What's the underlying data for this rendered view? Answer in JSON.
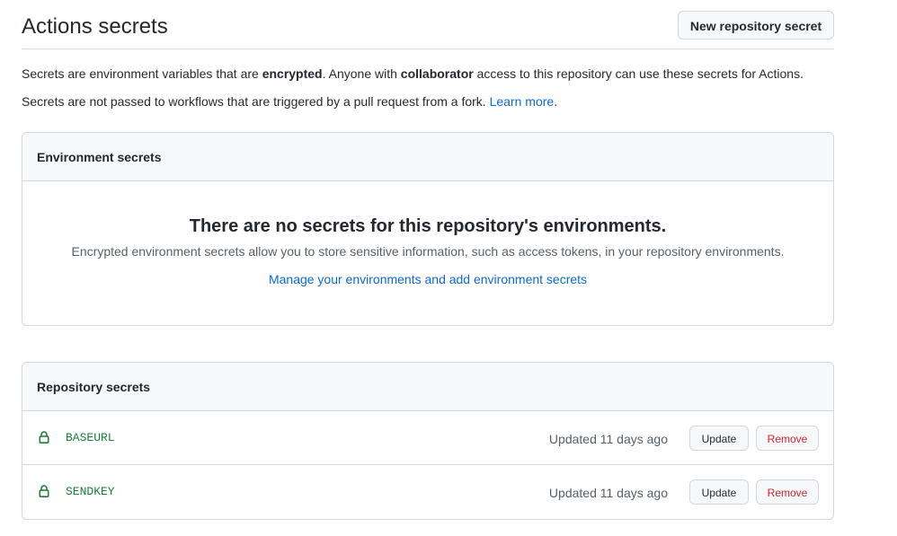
{
  "header": {
    "title": "Actions secrets",
    "new_secret_label": "New repository secret"
  },
  "description": {
    "line1_part1": "Secrets are environment variables that are ",
    "line1_bold1": "encrypted",
    "line1_part2": ". Anyone with ",
    "line1_bold2": "collaborator",
    "line1_part3": " access to this repository can use these secrets for Actions.",
    "line2_text": "Secrets are not passed to workflows that are triggered by a pull request from a fork. ",
    "line2_link": "Learn more",
    "line2_end": "."
  },
  "environment_secrets": {
    "header": "Environment secrets",
    "blank_title": "There are no secrets for this repository's environments.",
    "blank_description": "Encrypted environment secrets allow you to store sensitive information, such as access tokens, in your repository environments.",
    "blank_link": "Manage your environments and add environment secrets"
  },
  "repository_secrets": {
    "header": "Repository secrets",
    "items": [
      {
        "name": "BASEURL",
        "updated": "Updated 11 days ago",
        "update_label": "Update",
        "remove_label": "Remove",
        "icon": "lock-icon"
      },
      {
        "name": "SENDKEY",
        "updated": "Updated 11 days ago",
        "update_label": "Update",
        "remove_label": "Remove",
        "icon": "lock-icon"
      }
    ]
  },
  "colors": {
    "link": "#0969da",
    "secret_name": "#1a7f37",
    "danger": "#cf222e",
    "muted": "#57606a",
    "border": "#d0d7de",
    "header_bg": "#f6f8fa"
  }
}
